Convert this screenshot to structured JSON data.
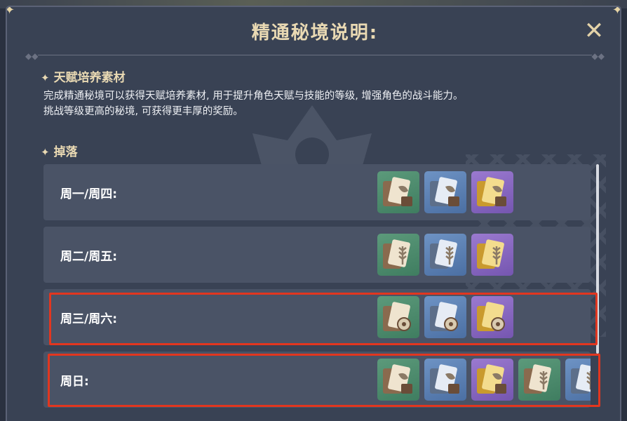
{
  "window": {
    "title": "精通秘境说明:",
    "close_glyph": "✕"
  },
  "sections": [
    {
      "star": "✦",
      "label": "天赋培养素材"
    },
    {
      "star": "✦",
      "label": "掉落"
    }
  ],
  "description": [
    "完成精通秘境可以获得天赋培养素材, 用于提升角色天赋与技能的等级, 增强角色的战斗能力。",
    "挑战等级更高的秘境, 可获得更丰厚的奖励。"
  ],
  "drops": [
    {
      "day": "周一/周四:",
      "materials": [
        {
          "rarity": "green",
          "icon": "scroll-book-icon"
        },
        {
          "rarity": "blue",
          "icon": "scroll-book-icon"
        },
        {
          "rarity": "purple",
          "icon": "scroll-book-icon"
        }
      ]
    },
    {
      "day": "周二/周五:",
      "materials": [
        {
          "rarity": "green",
          "icon": "wheat-book-icon"
        },
        {
          "rarity": "blue",
          "icon": "wheat-book-icon"
        },
        {
          "rarity": "purple",
          "icon": "wheat-book-icon"
        }
      ]
    },
    {
      "day": "周三/周六:",
      "materials": [
        {
          "rarity": "green",
          "icon": "dice-book-icon"
        },
        {
          "rarity": "blue",
          "icon": "dice-book-icon"
        },
        {
          "rarity": "purple",
          "icon": "dice-book-icon"
        }
      ]
    },
    {
      "day": "周日:",
      "materials": [
        {
          "rarity": "green",
          "icon": "scroll-book-icon"
        },
        {
          "rarity": "blue",
          "icon": "scroll-book-icon"
        },
        {
          "rarity": "purple",
          "icon": "scroll-book-icon"
        },
        {
          "rarity": "green",
          "icon": "wheat-book-icon"
        },
        {
          "rarity": "blue",
          "icon": "wheat-book-icon"
        }
      ]
    }
  ],
  "colors": {
    "highlight": "#e2361f",
    "gold_text": "#e9d9b3",
    "panel_bg": "#394254",
    "row_bg": "#4a5366"
  }
}
